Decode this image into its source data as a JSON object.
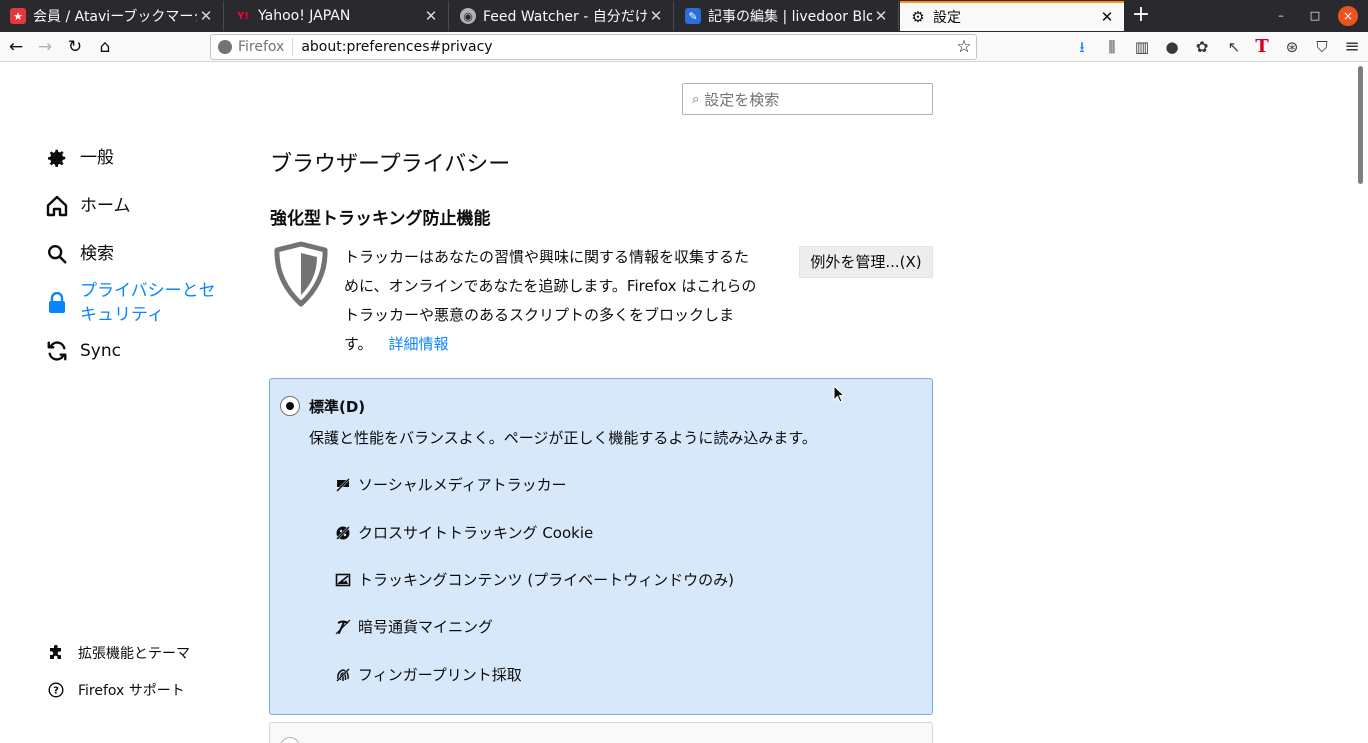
{
  "tabs": [
    {
      "title": "会員 / Ataviーブックマーク",
      "favicon": "atavi-icon",
      "active": false
    },
    {
      "title": "Yahoo! JAPAN",
      "favicon": "yahoo-icon",
      "active": false
    },
    {
      "title": "Feed Watcher - 自分だけの",
      "favicon": "rss-icon",
      "active": false
    },
    {
      "title": "記事の編集 | livedoor Blog",
      "favicon": "livedoor-icon",
      "active": false
    },
    {
      "title": "設定",
      "favicon": "gear-icon",
      "active": true
    }
  ],
  "window_controls": {
    "minimize": "–",
    "maximize": "□",
    "close": "×"
  },
  "urlbar": {
    "identity": "Firefox",
    "url": "about:preferences#privacy"
  },
  "search": {
    "placeholder": "設定を検索"
  },
  "sidebar": {
    "items": [
      {
        "label": "一般",
        "icon": "gear-icon"
      },
      {
        "label": "ホーム",
        "icon": "home-icon"
      },
      {
        "label": "検索",
        "icon": "search-icon"
      },
      {
        "label": "プライバシーとセキュリティ",
        "label_line1": "プライバシーとセ",
        "label_line2": "キュリティ",
        "icon": "lock-icon",
        "selected": true
      },
      {
        "label": "Sync",
        "icon": "sync-icon"
      }
    ],
    "footer": [
      {
        "label": "拡張機能とテーマ",
        "icon": "puzzle-icon"
      },
      {
        "label": "Firefox サポート",
        "icon": "help-icon"
      }
    ]
  },
  "main": {
    "heading": "ブラウザープライバシー",
    "section_title": "強化型トラッキング防止機能",
    "description": "トラッカーはあなたの習慣や興味に関する情報を収集するために、オンラインであなたを追跡します。Firefox はこれらのトラッカーや悪意のあるスクリプトの多くをブロックします。",
    "description_lines": [
      "トラッカーはあなたの習慣や興味に関する情報を収集するた",
      "めに、オンラインであなたを追跡します。Firefox はこれらの",
      "トラッカーや悪意のあるスクリプトの多くをブロックしま",
      "す。"
    ],
    "learn_more": "詳細情報",
    "exceptions_button": "例外を管理...(X)",
    "standard": {
      "title": "標準(D)",
      "description": "保護と性能をバランスよく。ページが正しく機能するように読み込みます。",
      "selected": true,
      "trackers": [
        {
          "label": "ソーシャルメディアトラッカー",
          "icon": "social-tracker-icon"
        },
        {
          "label": "クロスサイトトラッキング Cookie",
          "icon": "cookie-icon"
        },
        {
          "label": "トラッキングコンテンツ (プライベートウィンドウのみ)",
          "icon": "tracking-content-icon"
        },
        {
          "label": "暗号通貨マイニング",
          "icon": "cryptominer-icon"
        },
        {
          "label": "フィンガープリント採取",
          "icon": "fingerprint-icon"
        }
      ]
    }
  },
  "colors": {
    "accent": "#0a84ff",
    "tabstrip": "#2a2a2e",
    "card_bg": "#d8e8fb",
    "card_border": "#7aa7e0",
    "active_tab_line": "#ff9400"
  }
}
